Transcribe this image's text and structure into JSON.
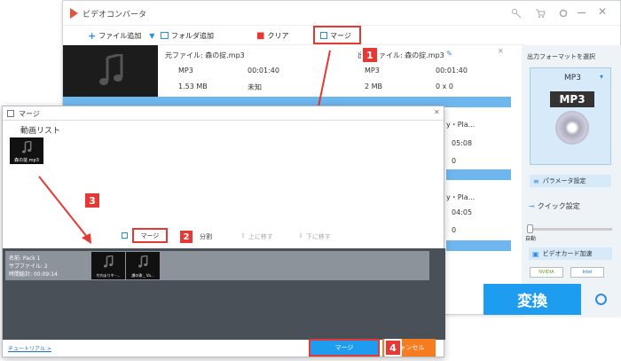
{
  "app": {
    "title": "ビデオコンバータ"
  },
  "toolbar": {
    "add_file": "ファイル追加",
    "add_folder": "フォルダ追加",
    "clear": "クリア",
    "merge": "マージ"
  },
  "file1": {
    "source_label": "元ファイル: 森の掟.mp3",
    "output_label": "出力ファイル: 森の掟.mp3",
    "src_format": "MP3",
    "src_duration": "00:01:40",
    "src_size": "1.53 MB",
    "src_resolution": "未知",
    "out_format": "MP3",
    "out_duration": "00:01:40",
    "out_size": "2 MB",
    "out_resolution": "0 x 0"
  },
  "partial_rows": [
    {
      "name": "y・Pla...",
      "duration": "05:08",
      "extra": "0"
    },
    {
      "name": "y・Pla...",
      "duration": "04:05",
      "extra": "0"
    },
    {
      "name": "",
      "duration": "",
      "extra": ""
    }
  ],
  "right_panel": {
    "select_format": "出力フォーマットを選択",
    "format": "MP3",
    "format_icon_label": "MP3",
    "param_settings": "パラメータ設定",
    "quick_settings": "クイック設定",
    "auto": "自動",
    "video_card_accel": "ビデオカード加速",
    "nvidia": "NVIDIA",
    "intel": "Intel",
    "convert": "変換"
  },
  "merge_dialog": {
    "title": "マージ",
    "video_list": "動画リスト",
    "list_items": [
      {
        "name": "森の掟.mp3"
      }
    ],
    "merge_button": "マージ",
    "split_button": "分割",
    "move_up": "上に移す",
    "move_down": "下に移す",
    "pack": {
      "name": "名前: Pack 1",
      "subfiles": "サブファイル: 2",
      "total_time": "時間総計: 00:09:14",
      "items": [
        {
          "name": "竹内まりや -..."
        },
        {
          "name": "讃の歌 _ Va..."
        }
      ]
    },
    "tutorial": "チュートリアル >",
    "ok_button": "マージ",
    "cancel_button": "キャンセル"
  },
  "annotations": {
    "badge1": "1",
    "badge2": "2",
    "badge3": "3",
    "badge4": "4"
  },
  "colors": {
    "accent": "#1e90ff",
    "annotation": "#e53935",
    "convert_bg": "#1e9df0",
    "dark_panel": "#4a5058"
  }
}
